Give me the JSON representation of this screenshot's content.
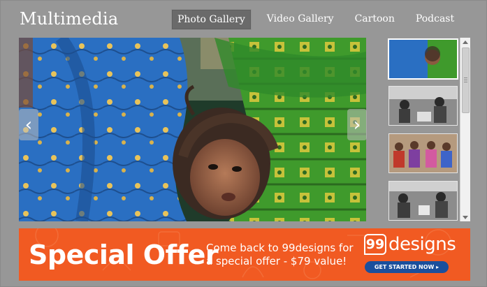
{
  "header": {
    "title": "Multimedia",
    "nav": [
      {
        "label": "Photo Gallery",
        "active": true
      },
      {
        "label": "Video Gallery",
        "active": false
      },
      {
        "label": "Cartoon",
        "active": false
      },
      {
        "label": "Podcast",
        "active": false
      }
    ]
  },
  "gallery": {
    "prev_icon": "chevron-left-icon",
    "next_icon": "chevron-right-icon",
    "prev_glyph": "‹",
    "next_glyph": "›",
    "thumbnails": [
      {
        "style": "color",
        "selected": true
      },
      {
        "style": "black-and-white",
        "selected": false
      },
      {
        "style": "color",
        "selected": false
      },
      {
        "style": "black-and-white",
        "selected": false
      }
    ]
  },
  "banner": {
    "headline": "Special Offer",
    "line1": "Come back to 99designs for",
    "line2": "a special offer - $79 value!",
    "logo_number": "99",
    "logo_word": "designs",
    "cta": "GET STARTED NOW ▸"
  },
  "colors": {
    "background": "#979797",
    "banner_orange": "#f15a22",
    "cta_blue": "#1b4f9c",
    "nav_active": "#6a6a6a"
  }
}
